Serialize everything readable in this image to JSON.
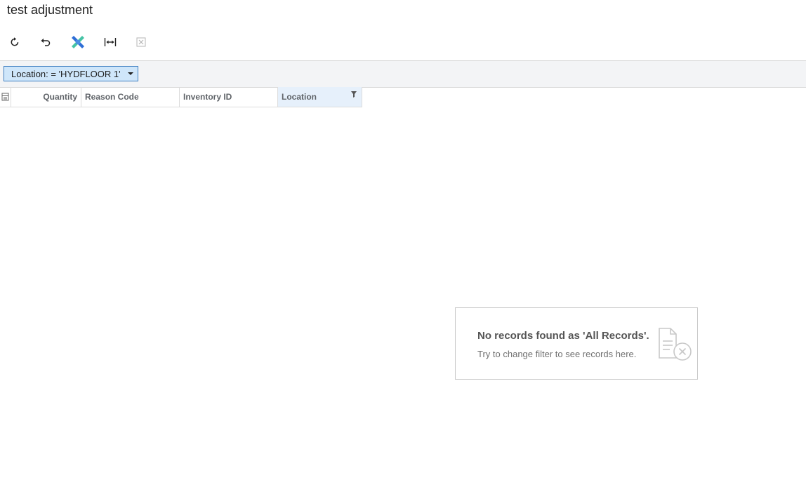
{
  "page": {
    "title": "test adjustment"
  },
  "toolbar": {
    "buttons": [
      {
        "name": "refresh-button",
        "icon": "refresh-icon"
      },
      {
        "name": "undo-button",
        "icon": "undo-icon"
      },
      {
        "name": "acumatica-button",
        "icon": "acumatica-logo-icon"
      },
      {
        "name": "fit-columns-button",
        "icon": "fit-width-icon"
      },
      {
        "name": "export-excel-button",
        "icon": "excel-icon",
        "disabled": true
      }
    ]
  },
  "filter": {
    "chip_label": "Location: = 'HYDFLOOR 1'"
  },
  "grid": {
    "columns": [
      {
        "label": ""
      },
      {
        "label": "Quantity"
      },
      {
        "label": "Reason Code"
      },
      {
        "label": "Inventory ID"
      },
      {
        "label": "Location"
      }
    ],
    "rows": []
  },
  "empty_state": {
    "title": "No records found as 'All Records'.",
    "subtitle": "Try to change filter to see records here."
  },
  "colors": {
    "accent": "#3f7fc1",
    "chip_bg": "#cfe6fa",
    "selected_column_bg": "#e6f0fb"
  }
}
